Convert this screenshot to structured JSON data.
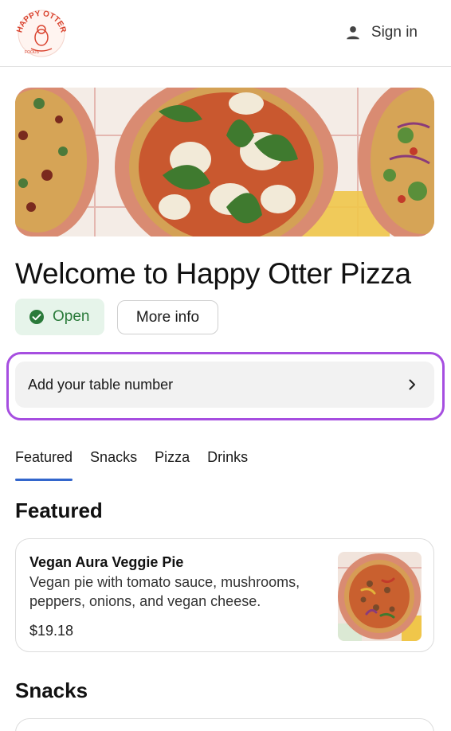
{
  "header": {
    "logo_text": "HAPPY OTTER",
    "logo_subtext": "FOODS",
    "signin_label": "Sign in"
  },
  "restaurant": {
    "title": "Welcome to Happy Otter Pizza",
    "status_label": "Open",
    "more_info_label": "More info"
  },
  "table": {
    "label": "Add your table number"
  },
  "tabs": [
    {
      "label": "Featured",
      "active": true
    },
    {
      "label": "Snacks",
      "active": false
    },
    {
      "label": "Pizza",
      "active": false
    },
    {
      "label": "Drinks",
      "active": false
    }
  ],
  "sections": {
    "featured_title": "Featured",
    "snacks_title": "Snacks"
  },
  "featured_items": [
    {
      "name": "Vegan Aura Veggie Pie",
      "description": "Vegan pie with tomato sauce, mushrooms, peppers, onions, and vegan cheese.",
      "price": "$19.18"
    }
  ],
  "colors": {
    "accent_tab": "#3366cc",
    "highlight_outline": "#a64ee0",
    "open_badge_bg": "#e6f4ea",
    "open_badge_text": "#2a7a3a",
    "logo_red": "#d9432f"
  },
  "icons": {
    "user": "person-icon",
    "status": "check-circle-icon",
    "table_row": "chevron-right-icon"
  }
}
